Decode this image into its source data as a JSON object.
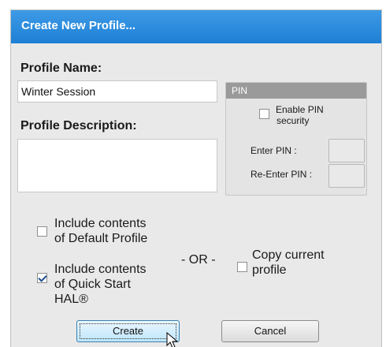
{
  "dialog": {
    "title": "Create New Profile...",
    "profile_name_label": "Profile Name:",
    "profile_name_value": "Winter Session",
    "profile_description_label": "Profile Description:",
    "profile_description_value": ""
  },
  "pin": {
    "header": "PIN",
    "enable_label_line1": "Enable PIN",
    "enable_label_line2": "security",
    "enable_checked": false,
    "enter_label": "Enter PIN :",
    "reenter_label": "Re-Enter PIN :"
  },
  "options": {
    "default_line1": "Include contents",
    "default_line2": "of Default Profile",
    "default_checked": false,
    "quickstart_line1": "Include contents",
    "quickstart_line2": "of Quick Start",
    "quickstart_line3": "HAL®",
    "quickstart_checked": true,
    "or_label": "- OR -",
    "copy_line1": "Copy current",
    "copy_line2": "profile",
    "copy_checked": false
  },
  "buttons": {
    "create": "Create",
    "cancel": "Cancel"
  },
  "colors": {
    "title_bar": "#1e7fd4",
    "dialog_bg": "#e9e9e9",
    "pin_header": "#9a9a9a"
  }
}
